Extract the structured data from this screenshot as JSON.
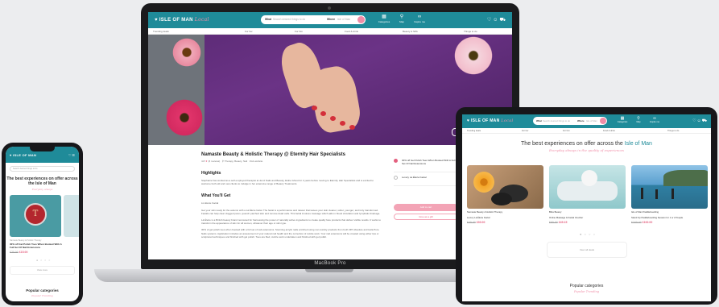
{
  "brand": {
    "name": "ISLE OF MAN",
    "script": "Local",
    "accent": "#1f8b99",
    "pink": "#f08da7"
  },
  "laptop": {
    "device_label": "MacBook Pro",
    "search": {
      "what_label": "What",
      "what_placeholder": "Search desired things to do",
      "where_label": "Where",
      "where_placeholder": "Isle of Man"
    },
    "nav": [
      {
        "icon": "grid-icon",
        "label": "Categories"
      },
      {
        "icon": "map-pin-icon",
        "label": "Map"
      },
      {
        "icon": "glasses-icon",
        "label": "Inspire me"
      }
    ],
    "subnav": [
      "Trending deals",
      "For her",
      "For him",
      "Food & drink",
      "Beauty & SPA",
      "Things to do"
    ],
    "hero_buttons": [
      "Favourite",
      "Share",
      "Gift"
    ],
    "listing": {
      "title": "Namaste Beauty & Holistic Therapy @ Eternity Hair Specialists",
      "rating": "4.8",
      "reviews": "(6 reviews)",
      "location": "Therapy, Beauty, Nail",
      "website": "Visit website",
      "highlights_heading": "Highlights",
      "highlights_text": "Stephanie has worked as a self employed therapist at Jemz Nails and Beauty, Eluhe Ghost for 4 years before moving to Eternity Hair Specialists and is excited to welcome both old and new clients to indulge in her extensive range of Beauty Treatments.",
      "get_heading": "What You'll Get",
      "get_sub": "Lis Elerie Facial",
      "get_text_1": "Get your skin ready for the autumn with a Lá Élerie facial. The facial is a performance and relaxer that leaves your skin cleaner, softer, younger, and truly transformed. Facials can help clear clogged pores, quench parched skin and remove dead cells. This facial involves massage which aids in blood circulation and lymphatic drainage.",
      "get_text_2": "Lá Élerie is a British beauty brand renowned for harnessing the power of naturally active ingredients to create quality face products that deliver visible results. It works to transform the appearance of skin for all women, whatever their age or skin type.",
      "get_text_3": "30% of gel polish toes when booked with a full set of nail extensions. Stunning acrylic nails enriched using non-toxicity products from both OPI Absolute and Hola Pure Nails systems. Application includes an assessment of your natural nail health and the correction of cuticle work. Your nail extensions will be created using either tips or sculptured techniques and finished with gel polish. Toes are filed, cuticle work undertaken and finished with gel polish."
    },
    "options": [
      {
        "label": "30% off Gel Polish Toes When Booked With A Full Set Of Nail Extensions",
        "selected": true
      },
      {
        "label": "Luxury Lá Élerie Facial",
        "selected": false
      }
    ],
    "add_to_cart": "Add to cart",
    "gift_button": "Give as a gift"
  },
  "tablet": {
    "search": {
      "what_label": "What",
      "what_placeholder": "Search desired things to do",
      "where_label": "Where",
      "where_placeholder": "Isle of Man"
    },
    "nav": [
      {
        "icon": "grid-icon",
        "label": "Categories"
      },
      {
        "icon": "map-pin-icon",
        "label": "Map"
      },
      {
        "icon": "glasses-icon",
        "label": "Inspire me"
      }
    ],
    "subnav": [
      "Trending deals",
      "For her",
      "For him",
      "Food & drink",
      "Things to do"
    ],
    "heading_pre": "The best experiences on offer across the ",
    "heading_hl": "Isle of Man",
    "tagline": "Everyday always in the quality of experiences",
    "cards": [
      {
        "category": "Namaste Beauty & Holistic Therapy",
        "title": "Luxury Lá Élerie Facial",
        "old": "£40.00",
        "new": "£30.00"
      },
      {
        "category": "Bliss Beauty",
        "title": "Online Massage & Facial Voucher",
        "old": "£60.00",
        "new": "£49.15"
      },
      {
        "category": "Isle of Man Paddleboarding",
        "title": "Stand Up Paddleboarding Session for 1 or 2 People",
        "old": "£240.00",
        "new": "£192.00"
      }
    ],
    "view_all": "View all deals",
    "popular": "Popular categories",
    "popular_sub": "Popular Trending"
  },
  "phone": {
    "search_placeholder": "Search desired things to do",
    "heading": "The best experiences on offer across the Isle of Man",
    "tagline": "Everyday always",
    "card": {
      "category": "Namaste Beauty & Holistic Therapy",
      "title": "30% off Gel Polish Toes When Booked With A Full Set Of Nail Extensions",
      "old": "£20.00",
      "new": "£15.00"
    },
    "view_all": "View more",
    "popular": "Popular categories",
    "popular_sub": "Popular Trending"
  }
}
